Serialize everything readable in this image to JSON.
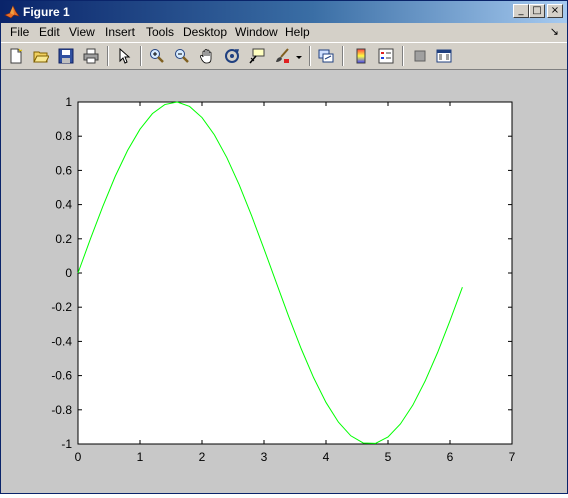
{
  "window": {
    "title": "Figure 1",
    "controls": {
      "minimize": "_",
      "maximize": "□",
      "close": "×"
    }
  },
  "menubar": {
    "items": [
      {
        "label": "File"
      },
      {
        "label": "Edit"
      },
      {
        "label": "View"
      },
      {
        "label": "Insert"
      },
      {
        "label": "Tools"
      },
      {
        "label": "Desktop"
      },
      {
        "label": "Window"
      },
      {
        "label": "Help"
      }
    ],
    "dock_arrow": "↘"
  },
  "toolbar": {
    "icons": [
      "new-figure-icon",
      "open-file-icon",
      "save-icon",
      "print-icon",
      "pointer-icon",
      "zoom-in-icon",
      "zoom-out-icon",
      "pan-icon",
      "rotate-3d-icon",
      "data-cursor-icon",
      "brush-icon",
      "brush-dropdown-icon",
      "link-plot-icon",
      "colorbar-icon",
      "legend-icon",
      "hide-plot-tools-icon",
      "show-plot-tools-icon"
    ]
  },
  "colors": {
    "line": "#00ff00",
    "axes_bg": "#ffffff",
    "figure_bg": "#c8c8c8"
  },
  "chart_data": {
    "type": "line",
    "title": "",
    "xlabel": "",
    "ylabel": "",
    "xlim": [
      0,
      7
    ],
    "ylim": [
      -1,
      1
    ],
    "xticks": [
      0,
      1,
      2,
      3,
      4,
      5,
      6,
      7
    ],
    "yticks": [
      -1,
      -0.8,
      -0.6,
      -0.4,
      -0.2,
      0,
      0.2,
      0.4,
      0.6,
      0.8,
      1
    ],
    "ytick_labels": [
      "-1",
      "-0.8",
      "-0.6",
      "-0.4",
      "-0.2",
      "0",
      "0.2",
      "0.4",
      "0.6",
      "0.8",
      "1"
    ],
    "xtick_labels": [
      "0",
      "1",
      "2",
      "3",
      "4",
      "5",
      "6",
      "7"
    ],
    "grid": false,
    "series": [
      {
        "color": "#00ff00",
        "x": [
          0,
          0.2,
          0.4,
          0.6,
          0.8,
          1.0,
          1.2,
          1.4,
          1.6,
          1.8,
          2.0,
          2.2,
          2.4,
          2.6,
          2.8,
          3.0,
          3.2,
          3.4,
          3.6,
          3.8,
          4.0,
          4.2,
          4.4,
          4.6,
          4.8,
          5.0,
          5.2,
          5.4,
          5.6,
          5.8,
          6.0,
          6.2
        ],
        "y": [
          0,
          0.199,
          0.389,
          0.565,
          0.717,
          0.841,
          0.932,
          0.985,
          1.0,
          0.974,
          0.909,
          0.808,
          0.675,
          0.516,
          0.335,
          0.141,
          -0.058,
          -0.256,
          -0.443,
          -0.612,
          -0.757,
          -0.872,
          -0.952,
          -0.994,
          -0.996,
          -0.959,
          -0.883,
          -0.773,
          -0.631,
          -0.465,
          -0.279,
          -0.083
        ]
      }
    ]
  }
}
